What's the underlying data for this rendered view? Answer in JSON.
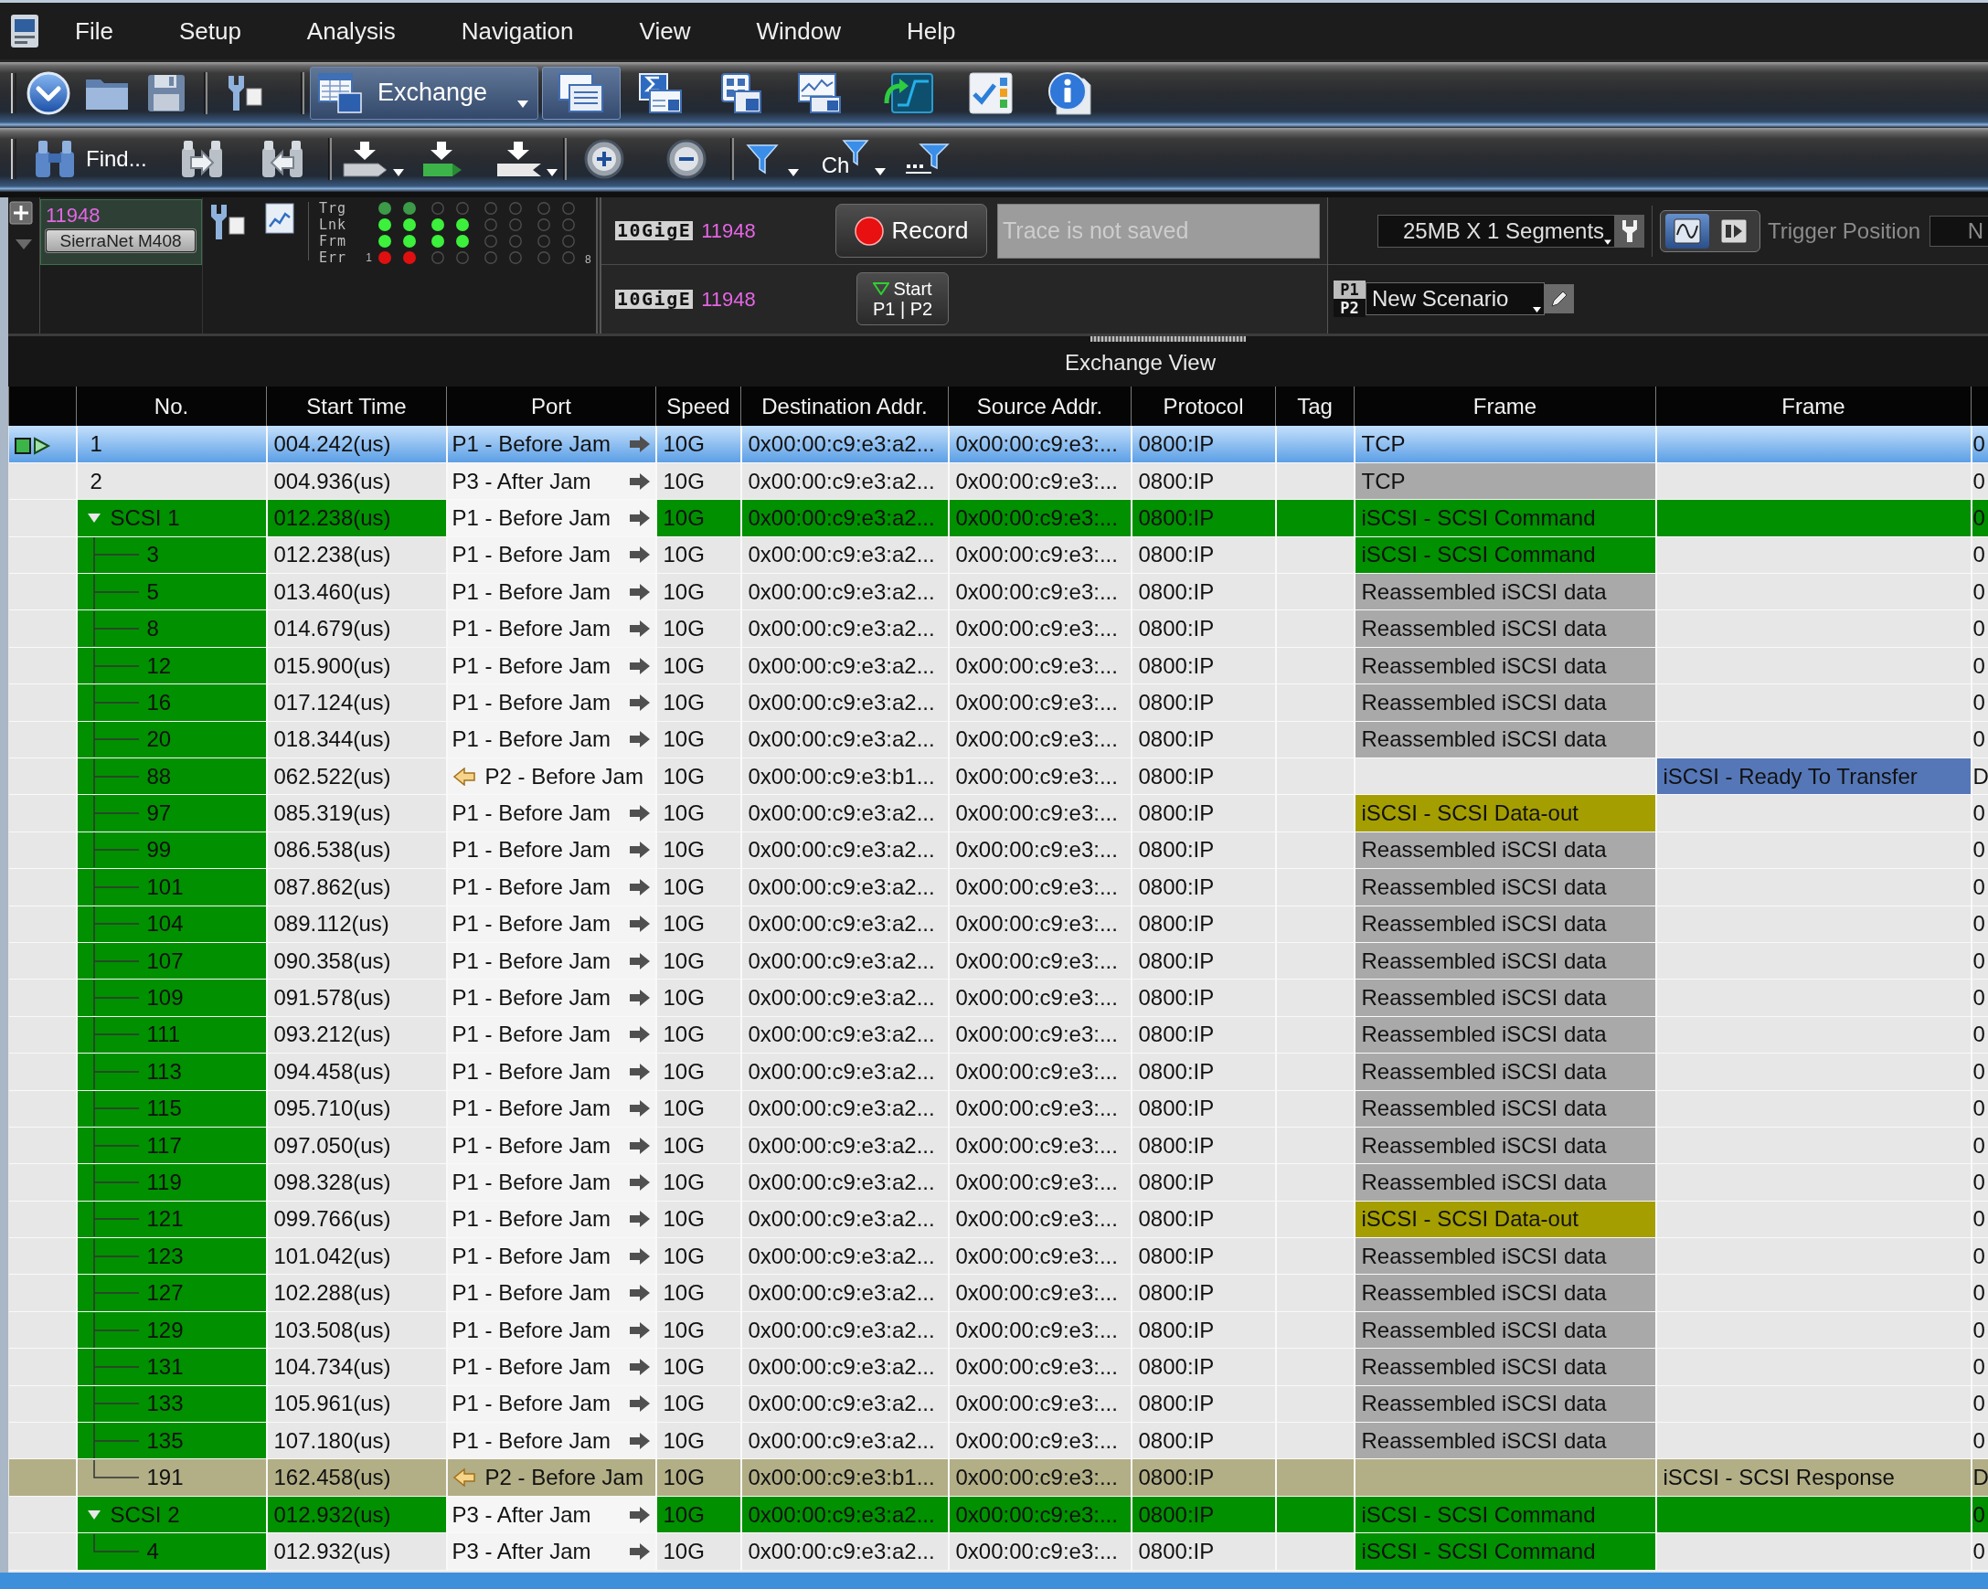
{
  "menu": {
    "items": [
      "File",
      "Setup",
      "Analysis",
      "Navigation",
      "View",
      "Window",
      "Help"
    ]
  },
  "toolbar": {
    "view_selector": {
      "label": "Exchange"
    },
    "view_buttons": [
      {
        "selected": true
      },
      {
        "selected": false
      },
      {
        "selected": false
      },
      {
        "selected": false
      }
    ]
  },
  "search_toolbar": {
    "find_button": {
      "label": "Find..."
    },
    "channel_filter": {
      "label": "Ch"
    }
  },
  "analyzer": {
    "id": "11948",
    "model": "SierraNet M408",
    "leds": [
      {
        "label": "Trg",
        "color": "#3c9a48",
        "lit": [
          true,
          true,
          false,
          false,
          false,
          false,
          false,
          false
        ]
      },
      {
        "label": "Lnk",
        "color": "#3cf03c",
        "lit": [
          true,
          true,
          true,
          true,
          false,
          false,
          false,
          false
        ]
      },
      {
        "label": "Frm",
        "color": "#3cf03c",
        "lit": [
          true,
          true,
          true,
          true,
          false,
          false,
          false,
          false
        ]
      },
      {
        "label": "Err",
        "color": "#e01010",
        "lit": [
          true,
          true,
          false,
          false,
          false,
          false,
          false,
          false
        ]
      }
    ],
    "first_port": "1",
    "last_port": "8"
  },
  "ports": [
    {
      "type": "10GigE",
      "id": "11948"
    },
    {
      "type": "10GigE",
      "id": "11948"
    }
  ],
  "record_button": {
    "label": "Record"
  },
  "trace_field": {
    "placeholder": "Trace is not saved"
  },
  "start_button": {
    "label": "Start",
    "ports": "P1 | P2"
  },
  "buffer_select": {
    "value": "25MB X 1 Segments"
  },
  "trigger_mode_buttons": [
    {
      "selected": true
    },
    {
      "selected": false
    }
  ],
  "trigger_position": {
    "label": "Trigger Position",
    "value": "N"
  },
  "scenario": {
    "ports": [
      {
        "label": "P1",
        "selected": true
      },
      {
        "label": "P2",
        "selected": false
      }
    ],
    "value": "New Scenario"
  },
  "exchange_view": {
    "title": "Exchange View"
  },
  "table": {
    "columns": [
      "No.",
      "Start Time",
      "Port",
      "Speed",
      "Destination Addr.",
      "Source Addr.",
      "Protocol",
      "Tag",
      "Frame",
      "Frame"
    ],
    "rows": [
      {
        "kind": "packet",
        "selected": true,
        "no": "1",
        "start_time": "004.242(us)",
        "port": {
          "text": "P1 - Before Jam",
          "inbound": false
        },
        "speed": "10G",
        "destination": "0x00:00:c9:e3:a2...",
        "source": "0x00:00:c9:e3:...",
        "protocol": "0800:IP",
        "frame": {
          "text": "TCP"
        },
        "column_12": "0"
      },
      {
        "kind": "packet",
        "selected": false,
        "no": "2",
        "start_time": "004.936(us)",
        "port": {
          "text": "P3 - After Jam",
          "inbound": false
        },
        "speed": "10G",
        "destination": "0x00:00:c9:e3:a2...",
        "source": "0x00:00:c9:e3:...",
        "protocol": "0800:IP",
        "frame": {
          "text": "TCP",
          "color": "#a9a9a9"
        },
        "column_12": "0"
      },
      {
        "kind": "group",
        "selected": false,
        "expanded": true,
        "color": "#009000",
        "no": "SCSI 1",
        "start_time": "012.238(us)",
        "port": {
          "text": "P1 - Before Jam",
          "inbound": false
        },
        "speed": "10G",
        "destination": "0x00:00:c9:e3:a2...",
        "source": "0x00:00:c9:e3:...",
        "protocol": "0800:IP",
        "frame": {
          "text": "iSCSI - SCSI Command"
        },
        "column_12": "0",
        "children": [
          {
            "selected": false,
            "no": "3",
            "start_time": "012.238(us)",
            "port": {
              "text": "P1 - Before Jam",
              "inbound": false
            },
            "speed": "10G",
            "destination": "0x00:00:c9:e3:a2...",
            "source": "0x00:00:c9:e3:...",
            "protocol": "0800:IP",
            "frame": {
              "text": "iSCSI - SCSI Command",
              "color": "#009000"
            },
            "column_12": "0"
          },
          {
            "selected": false,
            "no": "5",
            "start_time": "013.460(us)",
            "port": {
              "text": "P1 - Before Jam",
              "inbound": false
            },
            "speed": "10G",
            "destination": "0x00:00:c9:e3:a2...",
            "source": "0x00:00:c9:e3:...",
            "protocol": "0800:IP",
            "frame": {
              "text": "Reassembled iSCSI data",
              "color": "#a9a9a9"
            },
            "column_12": "0"
          },
          {
            "selected": false,
            "no": "8",
            "start_time": "014.679(us)",
            "port": {
              "text": "P1 - Before Jam",
              "inbound": false
            },
            "speed": "10G",
            "destination": "0x00:00:c9:e3:a2...",
            "source": "0x00:00:c9:e3:...",
            "protocol": "0800:IP",
            "frame": {
              "text": "Reassembled iSCSI data",
              "color": "#a9a9a9"
            },
            "column_12": "0"
          },
          {
            "selected": false,
            "no": "12",
            "start_time": "015.900(us)",
            "port": {
              "text": "P1 - Before Jam",
              "inbound": false
            },
            "speed": "10G",
            "destination": "0x00:00:c9:e3:a2...",
            "source": "0x00:00:c9:e3:...",
            "protocol": "0800:IP",
            "frame": {
              "text": "Reassembled iSCSI data",
              "color": "#a9a9a9"
            },
            "column_12": "0"
          },
          {
            "selected": false,
            "no": "16",
            "start_time": "017.124(us)",
            "port": {
              "text": "P1 - Before Jam",
              "inbound": false
            },
            "speed": "10G",
            "destination": "0x00:00:c9:e3:a2...",
            "source": "0x00:00:c9:e3:...",
            "protocol": "0800:IP",
            "frame": {
              "text": "Reassembled iSCSI data",
              "color": "#a9a9a9"
            },
            "column_12": "0"
          },
          {
            "selected": false,
            "no": "20",
            "start_time": "018.344(us)",
            "port": {
              "text": "P1 - Before Jam",
              "inbound": false
            },
            "speed": "10G",
            "destination": "0x00:00:c9:e3:a2...",
            "source": "0x00:00:c9:e3:...",
            "protocol": "0800:IP",
            "frame": {
              "text": "Reassembled iSCSI data",
              "color": "#a9a9a9"
            },
            "column_12": "0"
          },
          {
            "selected": false,
            "no": "88",
            "start_time": "062.522(us)",
            "port": {
              "text": "P2 - Before Jam",
              "inbound": true
            },
            "speed": "10G",
            "destination": "0x00:00:c9:e3:b1...",
            "source": "0x00:00:c9:e3:...",
            "protocol": "0800:IP",
            "frame_2": {
              "text": "iSCSI - Ready To Transfer",
              "color": "#5577b8"
            },
            "column_12": "D"
          },
          {
            "selected": false,
            "no": "97",
            "start_time": "085.319(us)",
            "port": {
              "text": "P1 - Before Jam",
              "inbound": false
            },
            "speed": "10G",
            "destination": "0x00:00:c9:e3:a2...",
            "source": "0x00:00:c9:e3:...",
            "protocol": "0800:IP",
            "frame": {
              "text": "iSCSI - SCSI Data-out",
              "color": "#a49e00"
            },
            "column_12": "0"
          },
          {
            "selected": false,
            "no": "99",
            "start_time": "086.538(us)",
            "port": {
              "text": "P1 - Before Jam",
              "inbound": false
            },
            "speed": "10G",
            "destination": "0x00:00:c9:e3:a2...",
            "source": "0x00:00:c9:e3:...",
            "protocol": "0800:IP",
            "frame": {
              "text": "Reassembled iSCSI data",
              "color": "#a9a9a9"
            },
            "column_12": "0"
          },
          {
            "selected": false,
            "no": "101",
            "start_time": "087.862(us)",
            "port": {
              "text": "P1 - Before Jam",
              "inbound": false
            },
            "speed": "10G",
            "destination": "0x00:00:c9:e3:a2...",
            "source": "0x00:00:c9:e3:...",
            "protocol": "0800:IP",
            "frame": {
              "text": "Reassembled iSCSI data",
              "color": "#a9a9a9"
            },
            "column_12": "0"
          },
          {
            "selected": false,
            "no": "104",
            "start_time": "089.112(us)",
            "port": {
              "text": "P1 - Before Jam",
              "inbound": false
            },
            "speed": "10G",
            "destination": "0x00:00:c9:e3:a2...",
            "source": "0x00:00:c9:e3:...",
            "protocol": "0800:IP",
            "frame": {
              "text": "Reassembled iSCSI data",
              "color": "#a9a9a9"
            },
            "column_12": "0"
          },
          {
            "selected": false,
            "no": "107",
            "start_time": "090.358(us)",
            "port": {
              "text": "P1 - Before Jam",
              "inbound": false
            },
            "speed": "10G",
            "destination": "0x00:00:c9:e3:a2...",
            "source": "0x00:00:c9:e3:...",
            "protocol": "0800:IP",
            "frame": {
              "text": "Reassembled iSCSI data",
              "color": "#a9a9a9"
            },
            "column_12": "0"
          },
          {
            "selected": false,
            "no": "109",
            "start_time": "091.578(us)",
            "port": {
              "text": "P1 - Before Jam",
              "inbound": false
            },
            "speed": "10G",
            "destination": "0x00:00:c9:e3:a2...",
            "source": "0x00:00:c9:e3:...",
            "protocol": "0800:IP",
            "frame": {
              "text": "Reassembled iSCSI data",
              "color": "#a9a9a9"
            },
            "column_12": "0"
          },
          {
            "selected": false,
            "no": "111",
            "start_time": "093.212(us)",
            "port": {
              "text": "P1 - Before Jam",
              "inbound": false
            },
            "speed": "10G",
            "destination": "0x00:00:c9:e3:a2...",
            "source": "0x00:00:c9:e3:...",
            "protocol": "0800:IP",
            "frame": {
              "text": "Reassembled iSCSI data",
              "color": "#a9a9a9"
            },
            "column_12": "0"
          },
          {
            "selected": false,
            "no": "113",
            "start_time": "094.458(us)",
            "port": {
              "text": "P1 - Before Jam",
              "inbound": false
            },
            "speed": "10G",
            "destination": "0x00:00:c9:e3:a2...",
            "source": "0x00:00:c9:e3:...",
            "protocol": "0800:IP",
            "frame": {
              "text": "Reassembled iSCSI data",
              "color": "#a9a9a9"
            },
            "column_12": "0"
          },
          {
            "selected": false,
            "no": "115",
            "start_time": "095.710(us)",
            "port": {
              "text": "P1 - Before Jam",
              "inbound": false
            },
            "speed": "10G",
            "destination": "0x00:00:c9:e3:a2...",
            "source": "0x00:00:c9:e3:...",
            "protocol": "0800:IP",
            "frame": {
              "text": "Reassembled iSCSI data",
              "color": "#a9a9a9"
            },
            "column_12": "0"
          },
          {
            "selected": false,
            "no": "117",
            "start_time": "097.050(us)",
            "port": {
              "text": "P1 - Before Jam",
              "inbound": false
            },
            "speed": "10G",
            "destination": "0x00:00:c9:e3:a2...",
            "source": "0x00:00:c9:e3:...",
            "protocol": "0800:IP",
            "frame": {
              "text": "Reassembled iSCSI data",
              "color": "#a9a9a9"
            },
            "column_12": "0"
          },
          {
            "selected": false,
            "no": "119",
            "start_time": "098.328(us)",
            "port": {
              "text": "P1 - Before Jam",
              "inbound": false
            },
            "speed": "10G",
            "destination": "0x00:00:c9:e3:a2...",
            "source": "0x00:00:c9:e3:...",
            "protocol": "0800:IP",
            "frame": {
              "text": "Reassembled iSCSI data",
              "color": "#a9a9a9"
            },
            "column_12": "0"
          },
          {
            "selected": false,
            "no": "121",
            "start_time": "099.766(us)",
            "port": {
              "text": "P1 - Before Jam",
              "inbound": false
            },
            "speed": "10G",
            "destination": "0x00:00:c9:e3:a2...",
            "source": "0x00:00:c9:e3:...",
            "protocol": "0800:IP",
            "frame": {
              "text": "iSCSI - SCSI Data-out",
              "color": "#a49e00"
            },
            "column_12": "0"
          },
          {
            "selected": false,
            "no": "123",
            "start_time": "101.042(us)",
            "port": {
              "text": "P1 - Before Jam",
              "inbound": false
            },
            "speed": "10G",
            "destination": "0x00:00:c9:e3:a2...",
            "source": "0x00:00:c9:e3:...",
            "protocol": "0800:IP",
            "frame": {
              "text": "Reassembled iSCSI data",
              "color": "#a9a9a9"
            },
            "column_12": "0"
          },
          {
            "selected": false,
            "no": "127",
            "start_time": "102.288(us)",
            "port": {
              "text": "P1 - Before Jam",
              "inbound": false
            },
            "speed": "10G",
            "destination": "0x00:00:c9:e3:a2...",
            "source": "0x00:00:c9:e3:...",
            "protocol": "0800:IP",
            "frame": {
              "text": "Reassembled iSCSI data",
              "color": "#a9a9a9"
            },
            "column_12": "0"
          },
          {
            "selected": false,
            "no": "129",
            "start_time": "103.508(us)",
            "port": {
              "text": "P1 - Before Jam",
              "inbound": false
            },
            "speed": "10G",
            "destination": "0x00:00:c9:e3:a2...",
            "source": "0x00:00:c9:e3:...",
            "protocol": "0800:IP",
            "frame": {
              "text": "Reassembled iSCSI data",
              "color": "#a9a9a9"
            },
            "column_12": "0"
          },
          {
            "selected": false,
            "no": "131",
            "start_time": "104.734(us)",
            "port": {
              "text": "P1 - Before Jam",
              "inbound": false
            },
            "speed": "10G",
            "destination": "0x00:00:c9:e3:a2...",
            "source": "0x00:00:c9:e3:...",
            "protocol": "0800:IP",
            "frame": {
              "text": "Reassembled iSCSI data",
              "color": "#a9a9a9"
            },
            "column_12": "0"
          },
          {
            "selected": false,
            "no": "133",
            "start_time": "105.961(us)",
            "port": {
              "text": "P1 - Before Jam",
              "inbound": false
            },
            "speed": "10G",
            "destination": "0x00:00:c9:e3:a2...",
            "source": "0x00:00:c9:e3:...",
            "protocol": "0800:IP",
            "frame": {
              "text": "Reassembled iSCSI data",
              "color": "#a9a9a9"
            },
            "column_12": "0"
          },
          {
            "selected": false,
            "no": "135",
            "start_time": "107.180(us)",
            "port": {
              "text": "P1 - Before Jam",
              "inbound": false
            },
            "speed": "10G",
            "destination": "0x00:00:c9:e3:a2...",
            "source": "0x00:00:c9:e3:...",
            "protocol": "0800:IP",
            "frame": {
              "text": "Reassembled iSCSI data",
              "color": "#a9a9a9"
            },
            "column_12": "0"
          },
          {
            "selected": false,
            "color": "#b2ae86",
            "no": "191",
            "start_time": "162.458(us)",
            "port": {
              "text": "P2 - Before Jam",
              "inbound": true
            },
            "speed": "10G",
            "destination": "0x00:00:c9:e3:b1...",
            "source": "0x00:00:c9:e3:...",
            "protocol": "0800:IP",
            "frame_2": {
              "text": "iSCSI - SCSI Response"
            },
            "column_12": "D"
          }
        ]
      },
      {
        "kind": "group",
        "selected": false,
        "expanded": true,
        "color": "#009000",
        "no": "SCSI 2",
        "start_time": "012.932(us)",
        "port": {
          "text": "P3 - After Jam",
          "inbound": false
        },
        "speed": "10G",
        "destination": "0x00:00:c9:e3:a2...",
        "source": "0x00:00:c9:e3:...",
        "protocol": "0800:IP",
        "frame": {
          "text": "iSCSI - SCSI Command"
        },
        "column_12": "0",
        "children": [
          {
            "selected": false,
            "no": "4",
            "start_time": "012.932(us)",
            "port": {
              "text": "P3 - After Jam",
              "inbound": false
            },
            "speed": "10G",
            "destination": "0x00:00:c9:e3:a2...",
            "source": "0x00:00:c9:e3:...",
            "protocol": "0800:IP",
            "frame": {
              "text": "iSCSI - SCSI Command",
              "color": "#009000"
            },
            "column_12": "0"
          }
        ]
      }
    ]
  }
}
